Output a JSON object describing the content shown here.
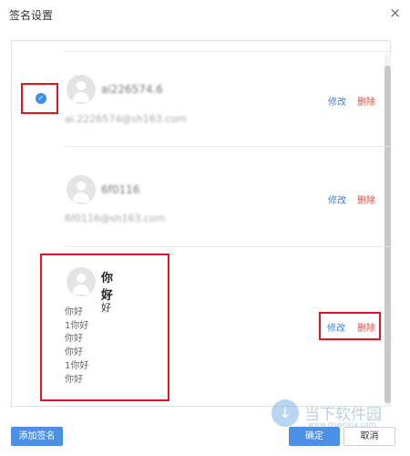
{
  "dialog": {
    "title": "签名设置",
    "close_icon": "×"
  },
  "signatures": [
    {
      "name": "ai226574.6",
      "email": "ai.2226574@sh163.com",
      "selected": true,
      "edit_label": "修改",
      "delete_label": "删除"
    },
    {
      "name": "6f0116",
      "email": "6f0116@sh163.com",
      "selected": false,
      "edit_label": "修改",
      "delete_label": "删除"
    },
    {
      "name": "你好",
      "subtitle": "你好",
      "lines": [
        "你好",
        "1你好",
        "你好",
        "你好",
        "1你好",
        "你好"
      ],
      "selected": false,
      "edit_label": "修改",
      "delete_label": "删除"
    }
  ],
  "check_icon": "✓",
  "footer": {
    "add_label": "添加签名",
    "ok_label": "确定",
    "cancel_label": "取消"
  },
  "watermark": {
    "text": "当下软件园",
    "url": "www.downxia.com",
    "logo_glyph": "↓"
  },
  "colors": {
    "accent": "#4c90e6",
    "link_edit": "#3f80d9",
    "link_delete": "#e24a4a",
    "highlight": "#e8121c"
  }
}
